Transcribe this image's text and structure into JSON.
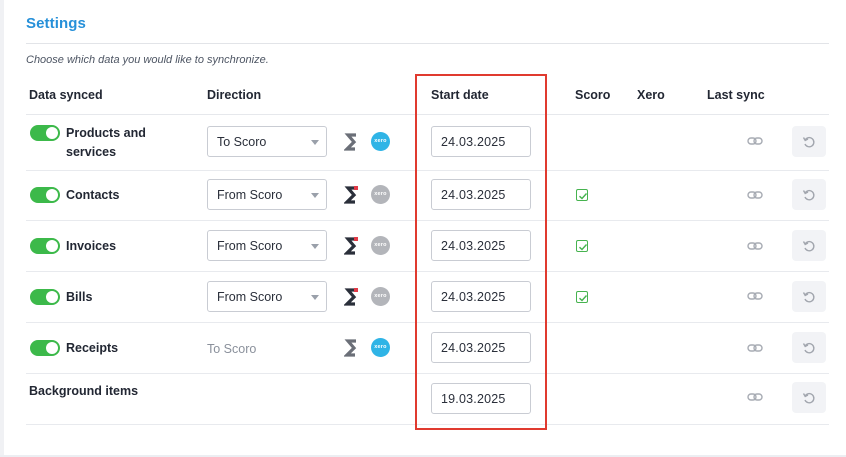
{
  "settings": {
    "title": "Settings",
    "subtitle": "Choose which data you would like to synchronize."
  },
  "table": {
    "headers": {
      "data_synced": "Data synced",
      "direction": "Direction",
      "start_date": "Start date",
      "scoro": "Scoro",
      "xero": "Xero",
      "last_sync": "Last sync"
    },
    "rows": [
      {
        "name": "Products and services",
        "enabled": true,
        "direction": "To Scoro",
        "direction_editable": true,
        "xero_active": true,
        "start_date": "24.03.2025",
        "scoro_checked": false
      },
      {
        "name": "Contacts",
        "enabled": true,
        "direction": "From Scoro",
        "direction_editable": true,
        "xero_active": false,
        "start_date": "24.03.2025",
        "scoro_checked": true
      },
      {
        "name": "Invoices",
        "enabled": true,
        "direction": "From Scoro",
        "direction_editable": true,
        "xero_active": false,
        "start_date": "24.03.2025",
        "scoro_checked": true
      },
      {
        "name": "Bills",
        "enabled": true,
        "direction": "From Scoro",
        "direction_editable": true,
        "xero_active": false,
        "start_date": "24.03.2025",
        "scoro_checked": true
      },
      {
        "name": "Receipts",
        "enabled": true,
        "direction": "To Scoro",
        "direction_editable": false,
        "xero_active": true,
        "start_date": "24.03.2025",
        "scoro_checked": false
      }
    ],
    "background": {
      "name": "Background items",
      "start_date": "19.03.2025"
    }
  },
  "logos": {
    "xero_text": "xero"
  },
  "icons": {
    "toggle": "toggle-on-icon",
    "scoro": "scoro-logo-icon",
    "xero": "xero-logo-icon",
    "caret": "chevron-down-icon",
    "check": "checkbox-checked-icon",
    "link": "link-icon",
    "undo": "undo-icon"
  },
  "colors": {
    "accent": "#2690d9",
    "toggle_on": "#3cb94a",
    "xero_active": "#2fb4e6",
    "xero_inactive": "#b3b5ba",
    "highlight": "#e03a2f"
  }
}
